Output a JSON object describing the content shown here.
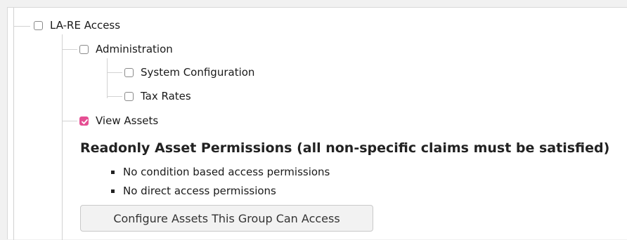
{
  "tree": {
    "root": {
      "label": "LA-RE Access",
      "checked": false
    },
    "administration": {
      "label": "Administration",
      "checked": false
    },
    "system_configuration": {
      "label": "System Configuration",
      "checked": false
    },
    "tax_rates": {
      "label": "Tax Rates",
      "checked": false
    },
    "view_assets": {
      "label": "View Assets",
      "checked": true
    }
  },
  "permissions": {
    "heading": "Readonly Asset Permissions (all non-specific claims must be satisfied)",
    "items": [
      "No condition based access permissions",
      "No direct access permissions"
    ],
    "configure_button": "Configure Assets This Group Can Access"
  },
  "colors": {
    "checked_accent": "#e54f93",
    "tree_line": "#d2d2d2",
    "background": "#f1f1f1"
  },
  "icons": {
    "checked": "checkmark-icon"
  }
}
